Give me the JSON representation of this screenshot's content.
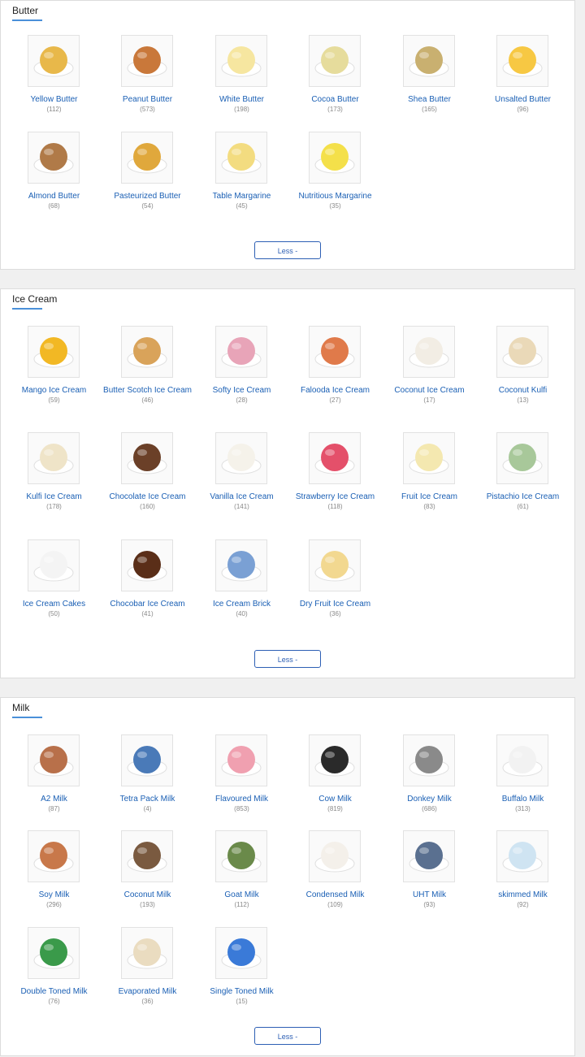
{
  "sections": [
    {
      "title": "Butter",
      "less_label": "Less -",
      "items": [
        {
          "name": "Yellow Butter",
          "count": "(112)",
          "color": "#e8b84a",
          "icon": "butter-block-icon"
        },
        {
          "name": "Peanut Butter",
          "count": "(573)",
          "color": "#c9783a",
          "icon": "peanut-butter-icon"
        },
        {
          "name": "White Butter",
          "count": "(198)",
          "color": "#f6e6a0",
          "icon": "butter-block-icon"
        },
        {
          "name": "Cocoa Butter",
          "count": "(173)",
          "color": "#e6dc9c",
          "icon": "cocoa-butter-icon"
        },
        {
          "name": "Shea Butter",
          "count": "(165)",
          "color": "#c9b070",
          "icon": "shea-butter-icon"
        },
        {
          "name": "Unsalted Butter",
          "count": "(96)",
          "color": "#f7c843",
          "icon": "butter-block-icon"
        },
        {
          "name": "Almond Butter",
          "count": "(68)",
          "color": "#b07a48",
          "icon": "almond-butter-icon"
        },
        {
          "name": "Pasteurized Butter",
          "count": "(54)",
          "color": "#e0a83c",
          "icon": "butter-curl-icon"
        },
        {
          "name": "Table Margarine",
          "count": "(45)",
          "color": "#f3dc80",
          "icon": "margarine-icon"
        },
        {
          "name": "Nutritious Margarine",
          "count": "(35)",
          "color": "#f4e04a",
          "icon": "margarine-icon"
        }
      ]
    },
    {
      "title": "Ice Cream",
      "less_label": "Less -",
      "items": [
        {
          "name": "Mango Ice Cream",
          "count": "(59)",
          "color": "#f2b824",
          "icon": "ice-cream-scoop-icon"
        },
        {
          "name": "Butter Scotch Ice Cream",
          "count": "(46)",
          "color": "#d9a35a",
          "icon": "ice-cream-scoop-icon"
        },
        {
          "name": "Softy Ice Cream",
          "count": "(28)",
          "color": "#e8a4b8",
          "icon": "soft-serve-icon"
        },
        {
          "name": "Falooda Ice Cream",
          "count": "(27)",
          "color": "#e07a4a",
          "icon": "falooda-glass-icon"
        },
        {
          "name": "Coconut Ice Cream",
          "count": "(17)",
          "color": "#f2ede4",
          "icon": "ice-cream-scoop-icon"
        },
        {
          "name": "Coconut Kulfi",
          "count": "(13)",
          "color": "#ead9b8",
          "icon": "kulfi-icon"
        },
        {
          "name": "Kulfi Ice Cream",
          "count": "(178)",
          "color": "#efe4c8",
          "icon": "kulfi-icon"
        },
        {
          "name": "Chocolate Ice Cream",
          "count": "(160)",
          "color": "#6b4028",
          "icon": "ice-cream-scoop-icon"
        },
        {
          "name": "Vanilla Ice Cream",
          "count": "(141)",
          "color": "#f5f2ea",
          "icon": "ice-cream-scoop-icon"
        },
        {
          "name": "Strawberry Ice Cream",
          "count": "(118)",
          "color": "#e4506a",
          "icon": "ice-cream-scoop-icon"
        },
        {
          "name": "Fruit Ice Cream",
          "count": "(83)",
          "color": "#f4e8b0",
          "icon": "ice-cream-scoop-icon"
        },
        {
          "name": "Pistachio Ice Cream",
          "count": "(61)",
          "color": "#a8c89a",
          "icon": "ice-cream-scoop-icon"
        },
        {
          "name": "Ice Cream Cakes",
          "count": "(50)",
          "color": "#f4f4f4",
          "icon": "cake-icon"
        },
        {
          "name": "Chocobar Ice Cream",
          "count": "(41)",
          "color": "#5a2e18",
          "icon": "ice-bar-icon"
        },
        {
          "name": "Ice Cream Brick",
          "count": "(40)",
          "color": "#7aa0d4",
          "icon": "ice-cream-box-icon"
        },
        {
          "name": "Dry Fruit Ice Cream",
          "count": "(36)",
          "color": "#f2d890",
          "icon": "sundae-icon"
        }
      ]
    },
    {
      "title": "Milk",
      "less_label": "Less -",
      "items": [
        {
          "name": "A2 Milk",
          "count": "(87)",
          "color": "#b8704a",
          "icon": "cow-icon"
        },
        {
          "name": "Tetra Pack Milk",
          "count": "(4)",
          "color": "#4a7ab8",
          "icon": "milk-carton-icon"
        },
        {
          "name": "Flavoured Milk",
          "count": "(853)",
          "color": "#f0a0b0",
          "icon": "milk-bottle-icon"
        },
        {
          "name": "Cow Milk",
          "count": "(819)",
          "color": "#2a2a2a",
          "icon": "cow-icon"
        },
        {
          "name": "Donkey Milk",
          "count": "(686)",
          "color": "#8a8a8a",
          "icon": "donkey-icon"
        },
        {
          "name": "Buffalo Milk",
          "count": "(313)",
          "color": "#f2f2f2",
          "icon": "milk-splash-icon"
        },
        {
          "name": "Soy Milk",
          "count": "(296)",
          "color": "#c8784a",
          "icon": "milk-carton-icon"
        },
        {
          "name": "Coconut Milk",
          "count": "(193)",
          "color": "#7a5a40",
          "icon": "coconut-icon"
        },
        {
          "name": "Goat Milk",
          "count": "(112)",
          "color": "#6a8a4a",
          "icon": "goat-icon"
        },
        {
          "name": "Condensed Milk",
          "count": "(109)",
          "color": "#f4f0ea",
          "icon": "coconut-icon"
        },
        {
          "name": "UHT Milk",
          "count": "(93)",
          "color": "#5a7090",
          "icon": "milk-glass-icon"
        },
        {
          "name": "skimmed Milk",
          "count": "(92)",
          "color": "#cfe4f2",
          "icon": "milk-glass-icon"
        },
        {
          "name": "Double Toned Milk",
          "count": "(76)",
          "color": "#3a9a4a",
          "icon": "milk-pouch-icon"
        },
        {
          "name": "Evaporated Milk",
          "count": "(36)",
          "color": "#eadcc0",
          "icon": "milk-bowl-icon"
        },
        {
          "name": "Single Toned Milk",
          "count": "(15)",
          "color": "#3a7ad8",
          "icon": "milk-pouch-icon"
        }
      ]
    }
  ]
}
